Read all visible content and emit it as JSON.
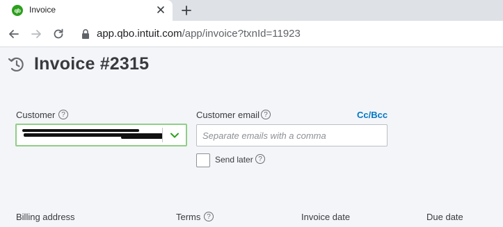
{
  "browser": {
    "tab": {
      "title": "Invoice",
      "favicon": "qb",
      "favicon_color": "#2ca01c"
    },
    "url": {
      "host": "app.qbo.intuit.com",
      "path": "/app/invoice?txnId=11923"
    }
  },
  "page": {
    "title": "Invoice #2315",
    "customer": {
      "label": "Customer",
      "value_redacted": true
    },
    "customer_email": {
      "label": "Customer email",
      "placeholder": "Separate emails with a comma",
      "value": ""
    },
    "cc_bcc_label": "Cc/Bcc",
    "send_later": {
      "label": "Send later",
      "checked": false
    },
    "fields_row": {
      "billing_address": "Billing address",
      "terms": "Terms",
      "invoice_date": "Invoice date",
      "due_date": "Due date"
    },
    "help_glyph": "?"
  },
  "colors": {
    "accent_link": "#0077c5",
    "focus_border": "#8ecf86",
    "chevron": "#2ca01c",
    "brand": "#2ca01c"
  },
  "icons": [
    "close-icon",
    "plus-icon",
    "back-arrow-icon",
    "forward-arrow-icon",
    "reload-icon",
    "lock-icon",
    "history-icon",
    "help-icon",
    "chevron-down-icon"
  ]
}
